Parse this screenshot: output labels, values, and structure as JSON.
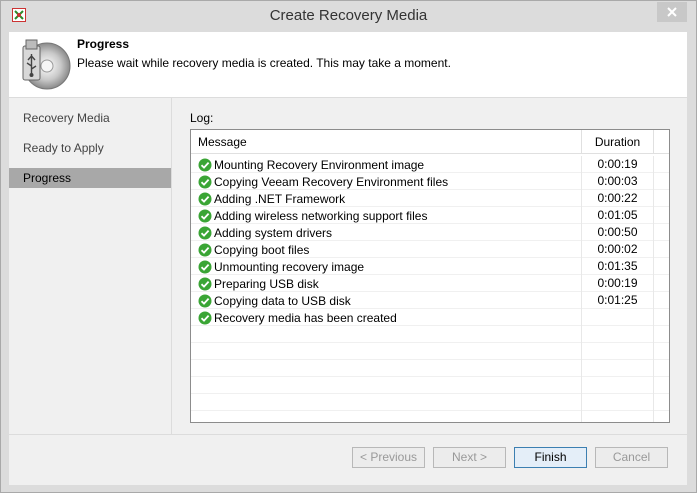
{
  "window": {
    "title": "Create Recovery Media",
    "close_symbol": "✕"
  },
  "header": {
    "icon": "usb-disc-icon",
    "title": "Progress",
    "description": "Please wait while recovery media is created. This may take a moment."
  },
  "sidebar": {
    "items": [
      {
        "label": "Recovery Media",
        "active": false
      },
      {
        "label": "Ready to Apply",
        "active": false
      },
      {
        "label": "Progress",
        "active": true
      }
    ]
  },
  "log": {
    "label": "Log:",
    "columns": {
      "message": "Message",
      "duration": "Duration"
    },
    "rows": [
      {
        "message": "Mounting Recovery Environment image",
        "duration": "0:00:19",
        "status": "success"
      },
      {
        "message": "Copying Veeam Recovery Environment files",
        "duration": "0:00:03",
        "status": "success"
      },
      {
        "message": "Adding .NET Framework",
        "duration": "0:00:22",
        "status": "success"
      },
      {
        "message": "Adding wireless networking support files",
        "duration": "0:01:05",
        "status": "success"
      },
      {
        "message": "Adding system drivers",
        "duration": "0:00:50",
        "status": "success"
      },
      {
        "message": "Copying boot files",
        "duration": "0:00:02",
        "status": "success"
      },
      {
        "message": "Unmounting recovery image",
        "duration": "0:01:35",
        "status": "success"
      },
      {
        "message": "Preparing USB disk",
        "duration": "0:00:19",
        "status": "success"
      },
      {
        "message": "Copying data to USB disk",
        "duration": "0:01:25",
        "status": "success"
      },
      {
        "message": "Recovery media has been created",
        "duration": "",
        "status": "success"
      }
    ],
    "empty_rows": 6
  },
  "buttons": {
    "previous": "< Previous",
    "next": "Next >",
    "finish": "Finish",
    "cancel": "Cancel"
  },
  "colors": {
    "success_green": "#3aa535",
    "active_sidebar": "#a8a8a8",
    "close_button": "#c8c8c8"
  }
}
